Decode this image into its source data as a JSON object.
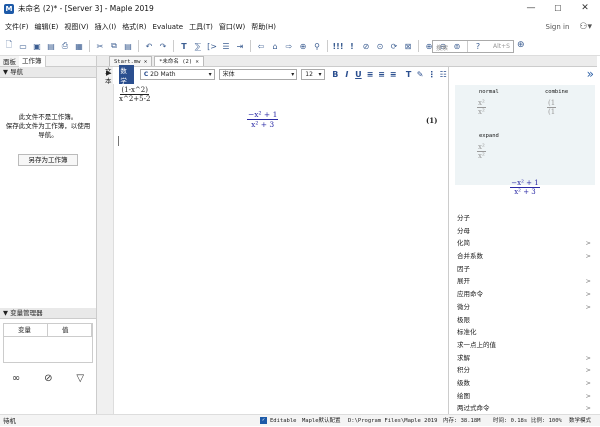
{
  "window": {
    "title": "未命名 (2)* - [Server 3] - Maple 2019",
    "minimize": "—",
    "maximize": "☐",
    "close": "✕"
  },
  "menu": [
    "文件(F)",
    "编辑(E)",
    "视图(V)",
    "插入(I)",
    "格式(R)",
    "Evaluate",
    "工具(T)",
    "窗口(W)",
    "帮助(H)"
  ],
  "sign_in": "Sign in",
  "search": {
    "placeholder": "搜索",
    "shortcut": "Alt+S"
  },
  "left_panel": {
    "tabs": [
      "面板",
      "工作簿"
    ],
    "navigator": {
      "title": "导航",
      "message_lines": [
        "此文件不是工作簿。",
        "保存此文件为工作簿，以使用",
        "导航。"
      ],
      "save_button": "另存为工作簿"
    },
    "variables": {
      "title": "变量管理器",
      "columns": [
        "变量",
        "值"
      ]
    }
  },
  "doc_tabs": [
    {
      "label": "Start.mw",
      "close": "✕"
    },
    {
      "label": "*未命名 (2)",
      "close": "✕"
    }
  ],
  "format_bar": {
    "mode_text": "文本",
    "mode_math": "数学",
    "input_type": "2D Math",
    "font": "宋体",
    "size": "12"
  },
  "document": {
    "input_num": "(1-x^2)",
    "input_den": "x^2+5-2",
    "output_num": "−x² + 1",
    "output_den": "x² + 3",
    "label": "(1)"
  },
  "palette": {
    "preview_labels": [
      "normal",
      "combine",
      "expand"
    ],
    "result_num": "−x² + 1",
    "result_den": "x² + 3",
    "operations": [
      {
        "label": "分子",
        "submenu": false
      },
      {
        "label": "分母",
        "submenu": false
      },
      {
        "label": "化简",
        "submenu": true
      },
      {
        "label": "合并系数",
        "submenu": true
      },
      {
        "label": "因子",
        "submenu": false
      },
      {
        "label": "展开",
        "submenu": true
      },
      {
        "label": "应用命令",
        "submenu": true
      },
      {
        "label": "微分",
        "submenu": true
      },
      {
        "label": "极限",
        "submenu": false
      },
      {
        "label": "标准化",
        "submenu": false
      },
      {
        "label": "求一点上的值",
        "submenu": false
      },
      {
        "label": "求解",
        "submenu": true
      },
      {
        "label": "积分",
        "submenu": true
      },
      {
        "label": "级数",
        "submenu": true
      },
      {
        "label": "绘图",
        "submenu": true
      },
      {
        "label": "两过式命令",
        "submenu": true
      }
    ]
  },
  "status": {
    "ready": "待机",
    "editable": "Editable",
    "config": "Maple默认配置",
    "path": "D:\\Program Files\\Maple 2019",
    "memory": "内存: 38.18M",
    "time": "时间: 0.18s",
    "zoom": "比例: 100%",
    "mode": "数学模式"
  }
}
